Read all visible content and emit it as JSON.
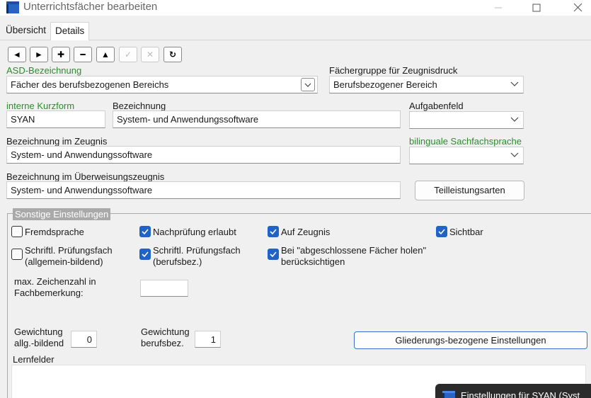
{
  "window": {
    "title": "Unterrichtsfächer bearbeiten",
    "icon": "app-window-icon",
    "controls": [
      "minimize",
      "maximize",
      "close"
    ]
  },
  "tabs": [
    {
      "label": "Übersicht",
      "active": false
    },
    {
      "label": "Details",
      "active": true
    }
  ],
  "toolbar": {
    "buttons": [
      {
        "name": "previous-record",
        "glyph": "◄",
        "enabled": true
      },
      {
        "name": "next-record",
        "glyph": "►",
        "enabled": true
      },
      {
        "name": "add-record",
        "glyph": "✚",
        "enabled": true
      },
      {
        "name": "delete-record",
        "glyph": "━",
        "enabled": true
      },
      {
        "name": "move-up",
        "glyph": "▲",
        "enabled": true
      },
      {
        "name": "confirm",
        "glyph": "✓",
        "enabled": false
      },
      {
        "name": "cancel",
        "glyph": "✕",
        "enabled": false
      },
      {
        "name": "refresh",
        "glyph": "↻",
        "enabled": true
      }
    ]
  },
  "form": {
    "asd_label": "ASD-Bezeichnung",
    "asd_value": "Fächer des berufsbezogenen Bereichs",
    "faechergruppe_label": "Fächergruppe für Zeugnisdruck",
    "faechergruppe_value": "Berufsbezogener Bereich",
    "kurzform_label": "interne Kurzform",
    "kurzform_value": "SYAN",
    "bezeichnung_label": "Bezeichnung",
    "bezeichnung_value": "System- und Anwendungssoftware",
    "aufgabenfeld_label": "Aufgabenfeld",
    "aufgabenfeld_value": "",
    "zeugnis_label": "Bezeichnung im Zeugnis",
    "zeugnis_value": "System- und Anwendungssoftware",
    "bilingual_label": "bilinguale Sachfachsprache",
    "bilingual_value": "",
    "ueberweisung_label": "Bezeichnung im Überweisungszeugnis",
    "ueberweisung_value": "System- und Anwendungssoftware",
    "teilleistungen_button": "Teilleistungsarten"
  },
  "sonstige": {
    "title": "Sonstige Einstellungen",
    "checkboxes": {
      "fremdsprache": {
        "label": "Fremdsprache",
        "checked": false
      },
      "nachpruefung": {
        "label": "Nachprüfung erlaubt",
        "checked": true
      },
      "auf_zeugnis": {
        "label": "Auf Zeugnis",
        "checked": true
      },
      "sichtbar": {
        "label": "Sichtbar",
        "checked": true
      },
      "pruefungsfach_allg_l1": "Schriftl. Prüfungsfach",
      "pruefungsfach_allg_l2": "(allgemein-bildend)",
      "pruefungsfach_allg_checked": false,
      "pruefungsfach_beruf_l1": "Schriftl. Prüfungsfach",
      "pruefungsfach_beruf_l2": "(berufsbez.)",
      "pruefungsfach_beruf_checked": true,
      "abgeschlossen_l1": "Bei \"abgeschlossene Fächer holen\"",
      "abgeschlossen_l2": "berücksichtigen",
      "abgeschlossen_checked": true
    },
    "max_zeichen_l1": "max. Zeichenzahl in",
    "max_zeichen_l2": "Fachbemerkung:",
    "max_zeichen_value": "",
    "gewichtung_allg_l1": "Gewichtung",
    "gewichtung_allg_l2": "allg.-bildend",
    "gewichtung_allg_value": "0",
    "gewichtung_beruf_l1": "Gewichtung",
    "gewichtung_beruf_l2": "berufsbez.",
    "gewichtung_beruf_value": "1",
    "gliederung_button": "Gliederungs-bezogene Einstellungen",
    "lernfelder_label": "Lernfelder",
    "lernfelder_value": ""
  },
  "popup": {
    "text": "Einstellungen für SYAN (Syst"
  },
  "colors": {
    "accent": "#1f63c6",
    "green_label": "#2e8b2e",
    "group_border": "#a9a9a9"
  }
}
